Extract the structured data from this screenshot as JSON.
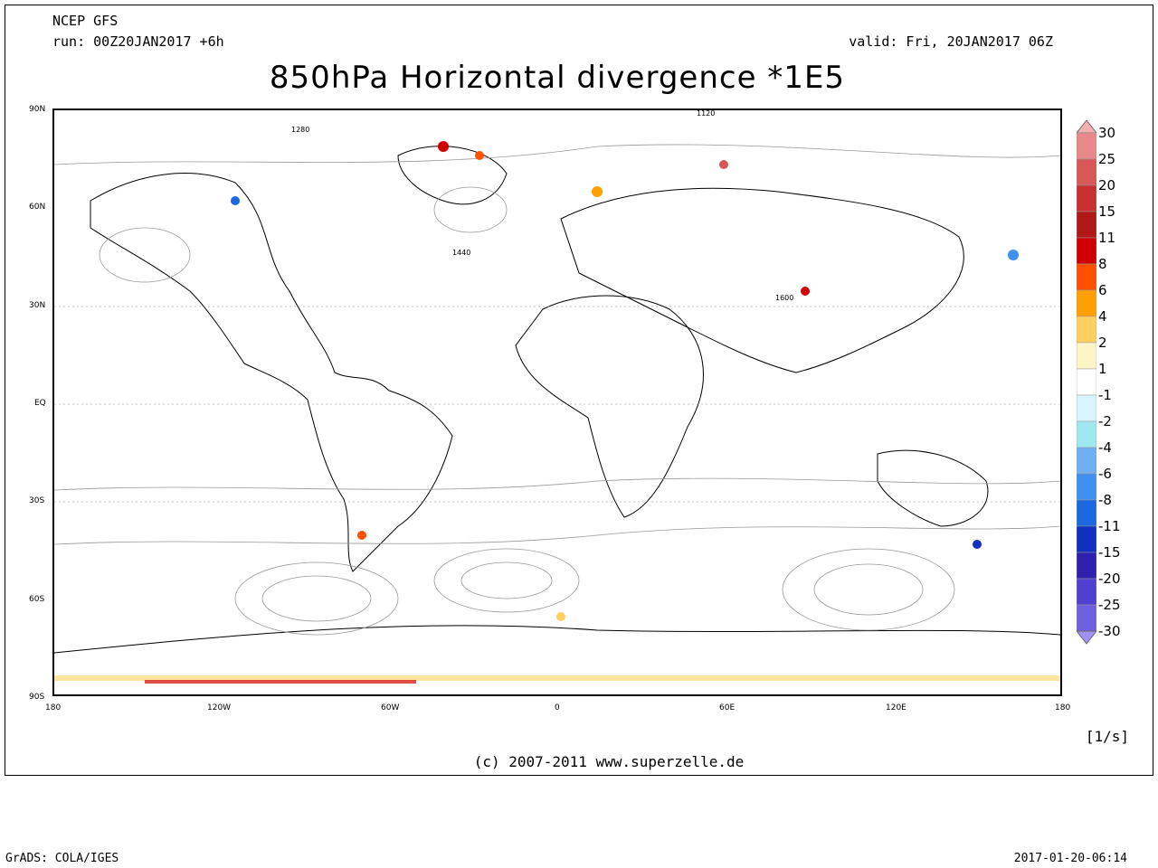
{
  "header": {
    "model": "NCEP GFS",
    "run": "run: 00Z20JAN2017 +6h",
    "valid": "valid: Fri, 20JAN2017 06Z",
    "title": "850hPa Horizontal divergence *1E5"
  },
  "axes": {
    "lat_labels": [
      "90N",
      "60N",
      "30N",
      "EQ",
      "30S",
      "60S",
      "90S"
    ],
    "lon_labels": [
      "180",
      "120W",
      "60W",
      "0",
      "60E",
      "120E",
      "180"
    ]
  },
  "contour_labels": [
    "1120",
    "1280",
    "1440",
    "1600"
  ],
  "legend": {
    "labels": [
      "30",
      "25",
      "20",
      "15",
      "11",
      "8",
      "6",
      "4",
      "2",
      "1",
      "-1",
      "-2",
      "-4",
      "-6",
      "-8",
      "-11",
      "-15",
      "-20",
      "-25",
      "-30"
    ],
    "colors": [
      "#f4b0b0",
      "#e88888",
      "#d85858",
      "#c83030",
      "#b01818",
      "#d00000",
      "#ff5000",
      "#ffa000",
      "#ffd060",
      "#fff4c8",
      "#ffffff",
      "#d8f4ff",
      "#a0e8f0",
      "#70b0f0",
      "#4090f0",
      "#1c68e0",
      "#1030c0",
      "#3020b0",
      "#5040d0",
      "#7060e0",
      "#a090f8"
    ]
  },
  "units": "[1/s]",
  "credit": "(c) 2007-2011 www.superzelle.de",
  "footer": {
    "left": "GrADS: COLA/IGES",
    "right": "2017-01-20-06:14"
  }
}
